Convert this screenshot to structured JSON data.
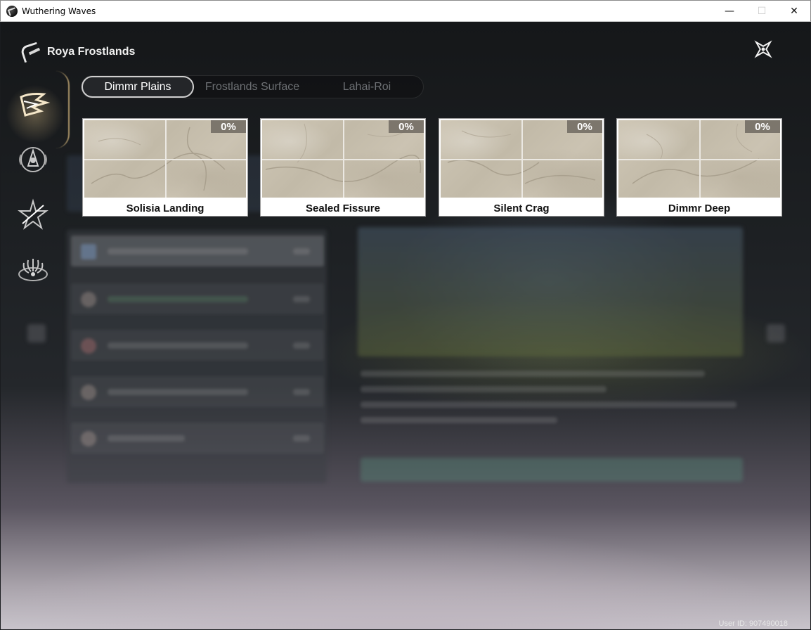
{
  "window": {
    "title": "Wuthering Waves",
    "minimize_glyph": "—",
    "maximize_glyph": "☐",
    "close_glyph": "✕"
  },
  "region": {
    "name": "Roya Frostlands"
  },
  "sidebar": {
    "items": [
      {
        "icon": "wuthering-logo-icon",
        "active": true
      },
      {
        "icon": "echo-mask-icon",
        "active": false
      },
      {
        "icon": "star-burst-icon",
        "active": false
      },
      {
        "icon": "tentacle-crest-icon",
        "active": false
      }
    ]
  },
  "tabs": [
    {
      "label": "Dimmr Plains",
      "active": true
    },
    {
      "label": "Frostlands Surface",
      "active": false
    },
    {
      "label": "Lahai-Roi",
      "active": false
    }
  ],
  "areas": [
    {
      "name": "Solisia Landing",
      "progress": "0%"
    },
    {
      "name": "Sealed Fissure",
      "progress": "0%"
    },
    {
      "name": "Silent Crag",
      "progress": "0%"
    },
    {
      "name": "Dimmr Deep",
      "progress": "0%"
    }
  ],
  "footer": {
    "user_id": "User ID: 907490018"
  },
  "colors": {
    "active_tab_border": "#cfcfcf",
    "inactive_tab_text": "#6d7074",
    "sidebar_accent": "#dcbe82"
  }
}
